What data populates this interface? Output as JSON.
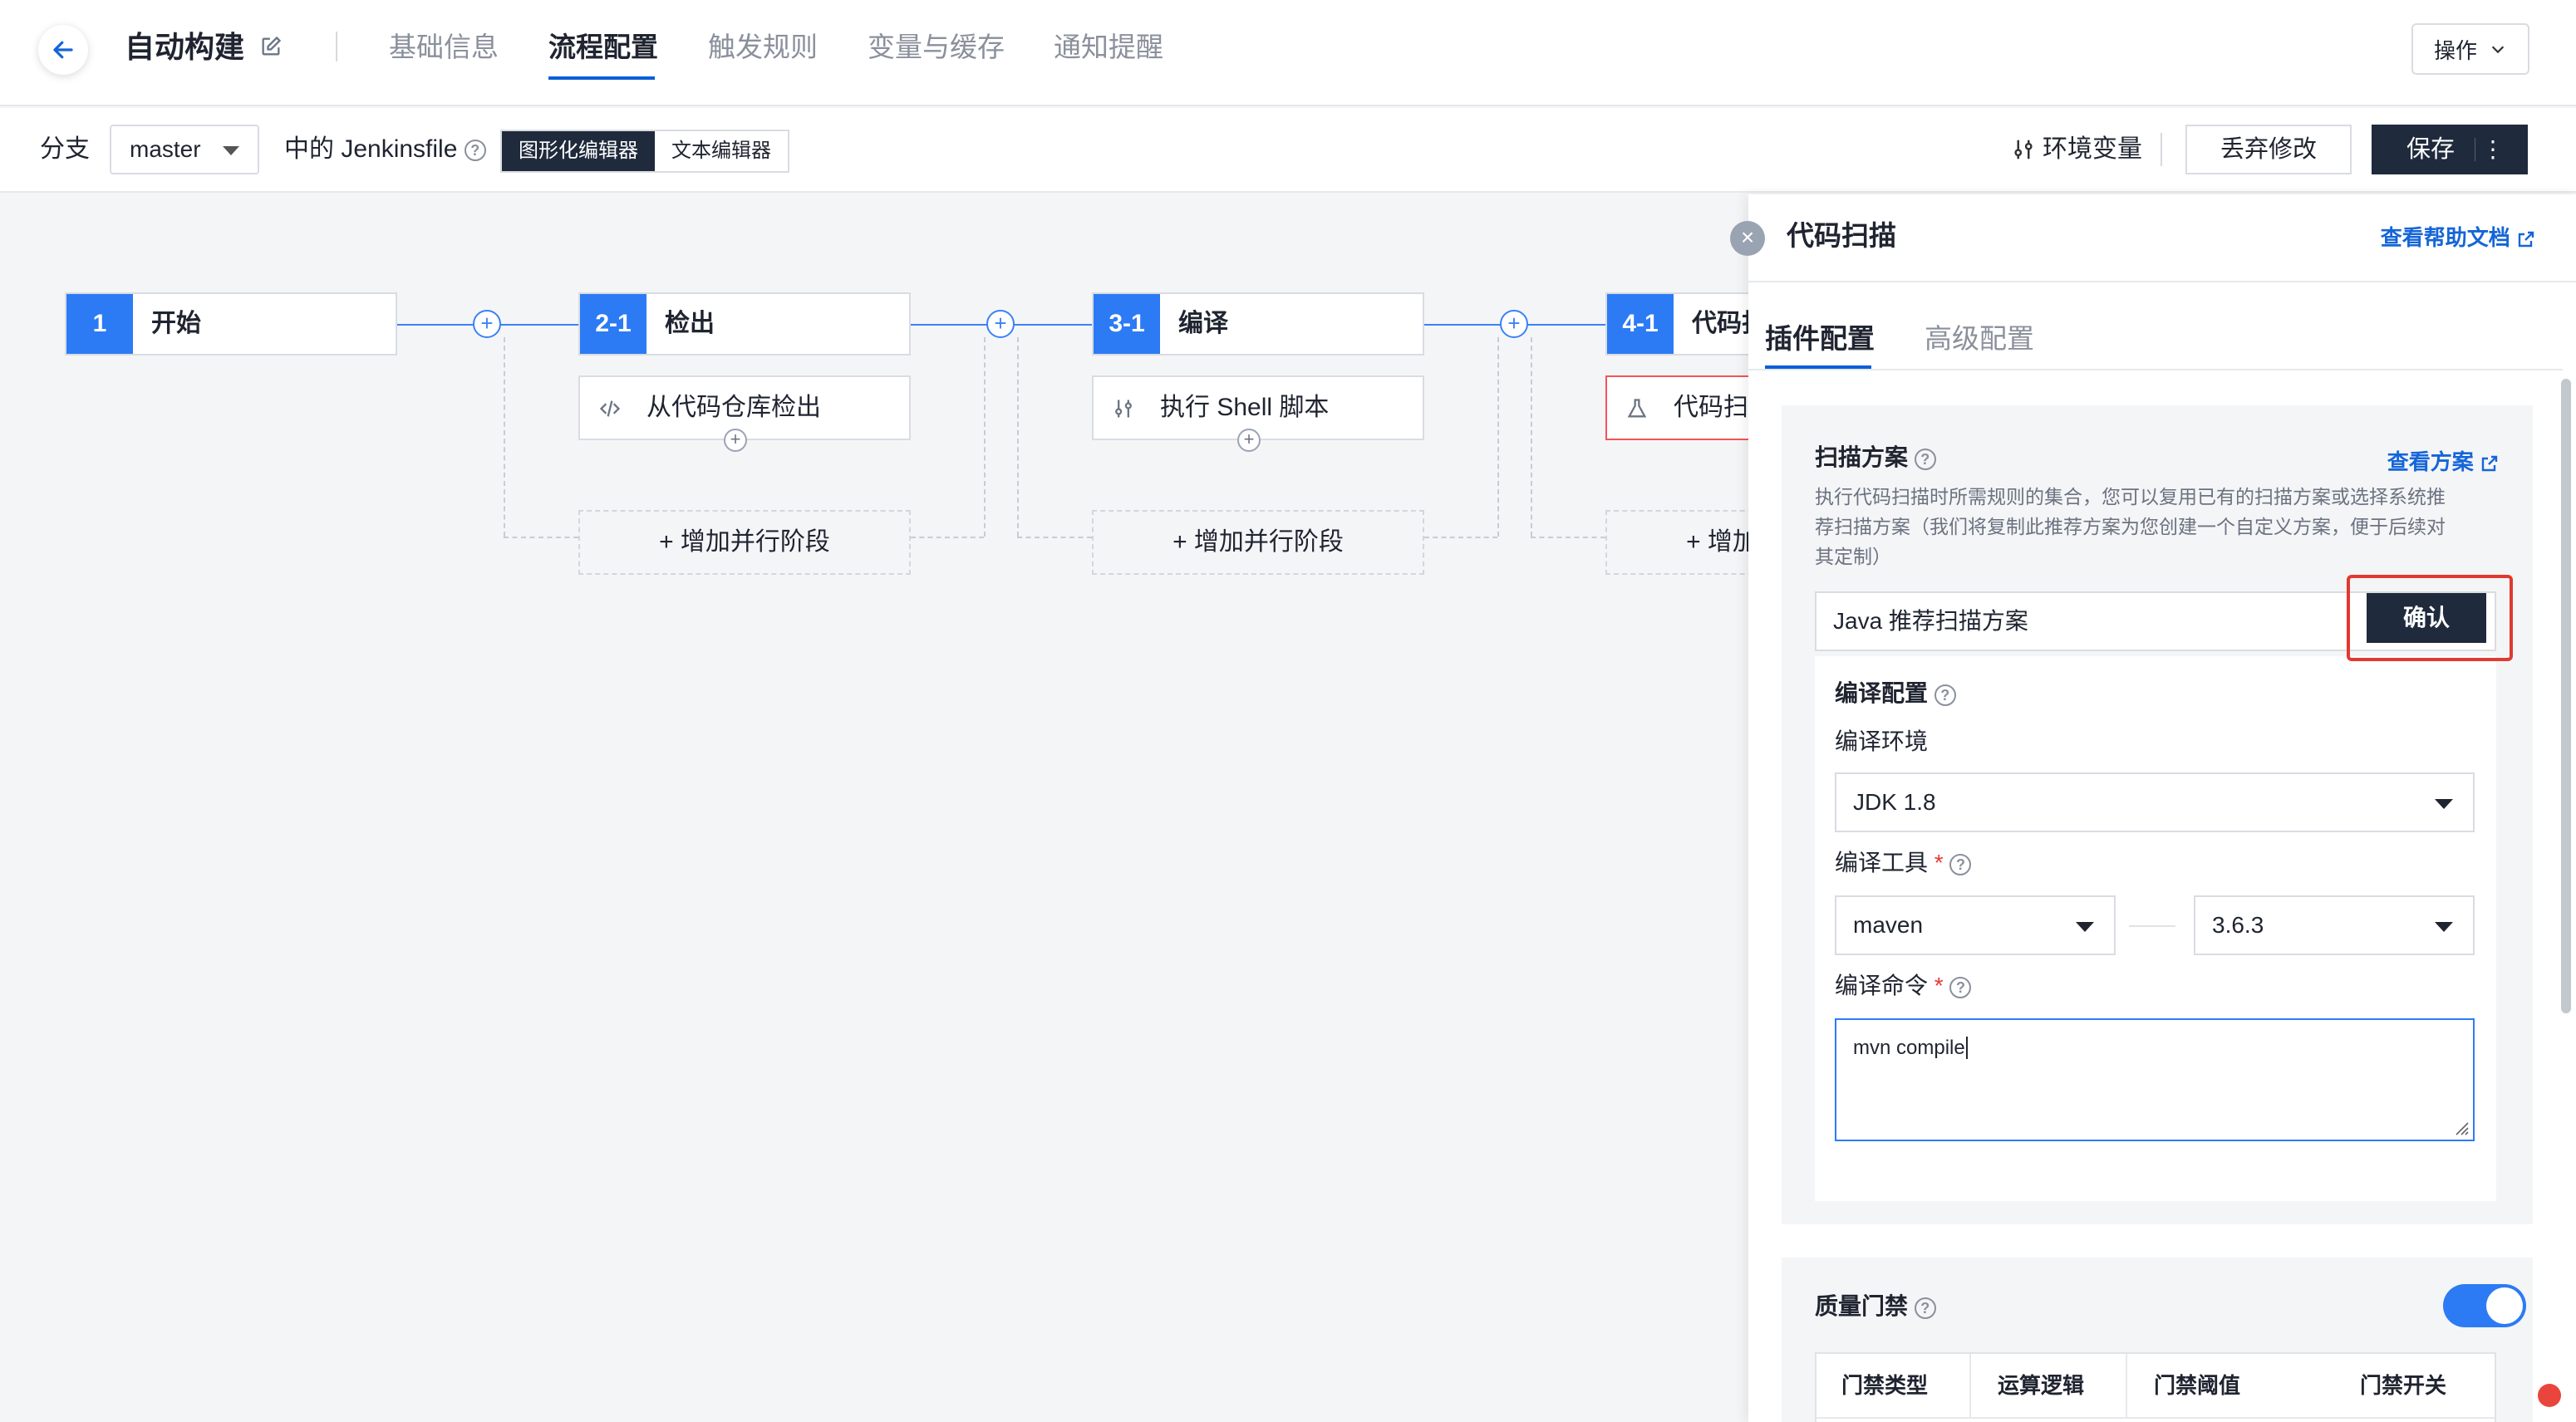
{
  "header": {
    "title": "自动构建",
    "tabs": [
      "基础信息",
      "流程配置",
      "触发规则",
      "变量与缓存",
      "通知提醒"
    ],
    "active_tab": "流程配置",
    "ops_label": "操作"
  },
  "toolbar": {
    "branch_label": "分支",
    "branch_value": "master",
    "jenkins_label": "中的 Jenkinsfile",
    "editor_graphic": "图形化编辑器",
    "editor_text": "文本编辑器",
    "env_var_label": "环境变量",
    "discard_label": "丢弃修改",
    "save_label": "保存"
  },
  "pipeline": {
    "stages": [
      {
        "num": "1",
        "name": "开始"
      },
      {
        "num": "2-1",
        "name": "检出",
        "step": "从代码仓库检出"
      },
      {
        "num": "3-1",
        "name": "编译",
        "step": "执行 Shell 脚本"
      },
      {
        "num": "4-1",
        "name": "代码扫描",
        "step": "代码扫描"
      }
    ],
    "add_parallel_label": "+ 增加并行阶段"
  },
  "panel": {
    "title": "代码扫描",
    "help_doc": "查看帮助文档",
    "tabs": [
      "插件配置",
      "高级配置"
    ],
    "scan_plan": {
      "title": "扫描方案",
      "view_link": "查看方案",
      "description_lines": [
        "执行代码扫描时所需规则的集合，您可以复用已有的扫描方案或选择系统推",
        "荐扫描方案（我们将复制此推荐方案为您创建一个自定义方案，便于后续对",
        "其定制）"
      ],
      "value": "Java 推荐扫描方案",
      "confirm_label": "确认"
    },
    "compile": {
      "title": "编译配置",
      "env_label": "编译环境",
      "env_value": "JDK 1.8",
      "tool_label": "编译工具",
      "tool_value": "maven",
      "tool_version": "3.6.3",
      "cmd_label": "编译命令",
      "cmd_value": "mvn compile"
    },
    "quality_gate": {
      "title": "质量门禁",
      "enabled": true,
      "columns": [
        "门禁类型",
        "运算逻辑",
        "门禁阈值",
        "门禁开关"
      ]
    }
  },
  "colors": {
    "accent": "#2c7bf5",
    "dark_button": "#1f2a3c",
    "link": "#1565d8",
    "highlight": "#e03a2f"
  }
}
